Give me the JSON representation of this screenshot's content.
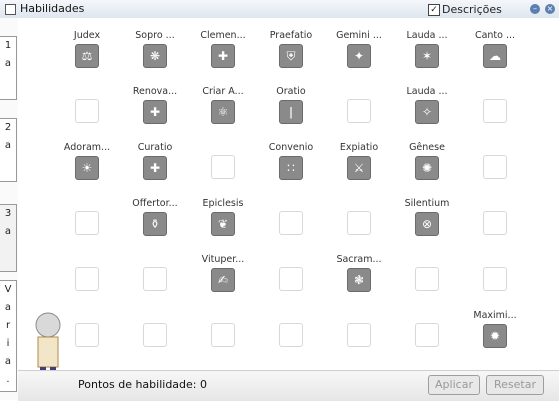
{
  "window": {
    "title": "Habilidades",
    "descriptions_label": "Descrições",
    "descriptions_checked": "✓"
  },
  "tabs": [
    {
      "chars": [
        "1",
        "a"
      ]
    },
    {
      "chars": [
        "2",
        "a"
      ]
    },
    {
      "chars": [
        "3",
        "a"
      ]
    },
    {
      "chars": [
        "V",
        "a",
        "r",
        "i",
        "a",
        "."
      ]
    }
  ],
  "skills": [
    {
      "name": "Judex",
      "icon": "⚖"
    },
    {
      "name": "Sopro ...",
      "icon": "❋"
    },
    {
      "name": "Clemen...",
      "icon": "✚"
    },
    {
      "name": "Praefatio",
      "icon": "⛨"
    },
    {
      "name": "Gemini ...",
      "icon": "✦"
    },
    {
      "name": "Lauda ...",
      "icon": "✶"
    },
    {
      "name": "Canto ...",
      "icon": "☁"
    },
    {
      "name": "Renova...",
      "icon": "✚"
    },
    {
      "name": "Criar A...",
      "icon": "⚛"
    },
    {
      "name": "Oratio",
      "icon": "ǀ"
    },
    {
      "name": "Lauda ...",
      "icon": "✧"
    },
    {
      "name": "Adoram...",
      "icon": "☀"
    },
    {
      "name": "Curatio",
      "icon": "✚"
    },
    {
      "name": "Convenio",
      "icon": "∷"
    },
    {
      "name": "Expiatio",
      "icon": "⚔"
    },
    {
      "name": "Gênese",
      "icon": "✺"
    },
    {
      "name": "Offertor...",
      "icon": "⚱"
    },
    {
      "name": "Epiclesis",
      "icon": "❦"
    },
    {
      "name": "Silentium",
      "icon": "⊗"
    },
    {
      "name": "Vituper...",
      "icon": "✍"
    },
    {
      "name": "Sacram...",
      "icon": "❃"
    },
    {
      "name": "Maximi...",
      "icon": "✹"
    }
  ],
  "footer": {
    "points_label": "Pontos de habilidade: 0",
    "apply_label": "Aplicar",
    "reset_label": "Resetar"
  }
}
